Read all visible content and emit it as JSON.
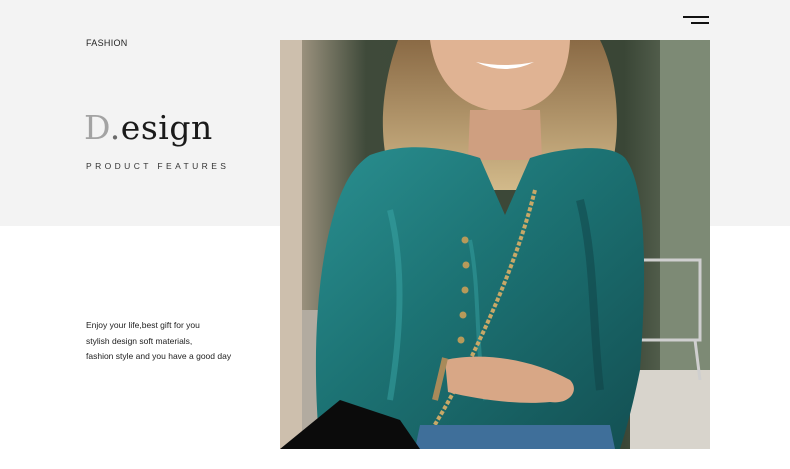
{
  "header": {
    "kicker": "FASHION",
    "menu_icon": "hamburger-menu-icon"
  },
  "hero": {
    "title_first_letter": "D",
    "title_dot": ".",
    "title_rest": "esign",
    "subtitle": "PRODUCT FEATURES"
  },
  "description": {
    "lines": [
      "Enjoy your life,best gift for you",
      "stylish design soft materials,",
      "fashion style and you have a good day"
    ]
  },
  "colors": {
    "band": "#f3f3f3",
    "blouse": "#1e7e80",
    "accent_grey": "#a3a3a3"
  }
}
